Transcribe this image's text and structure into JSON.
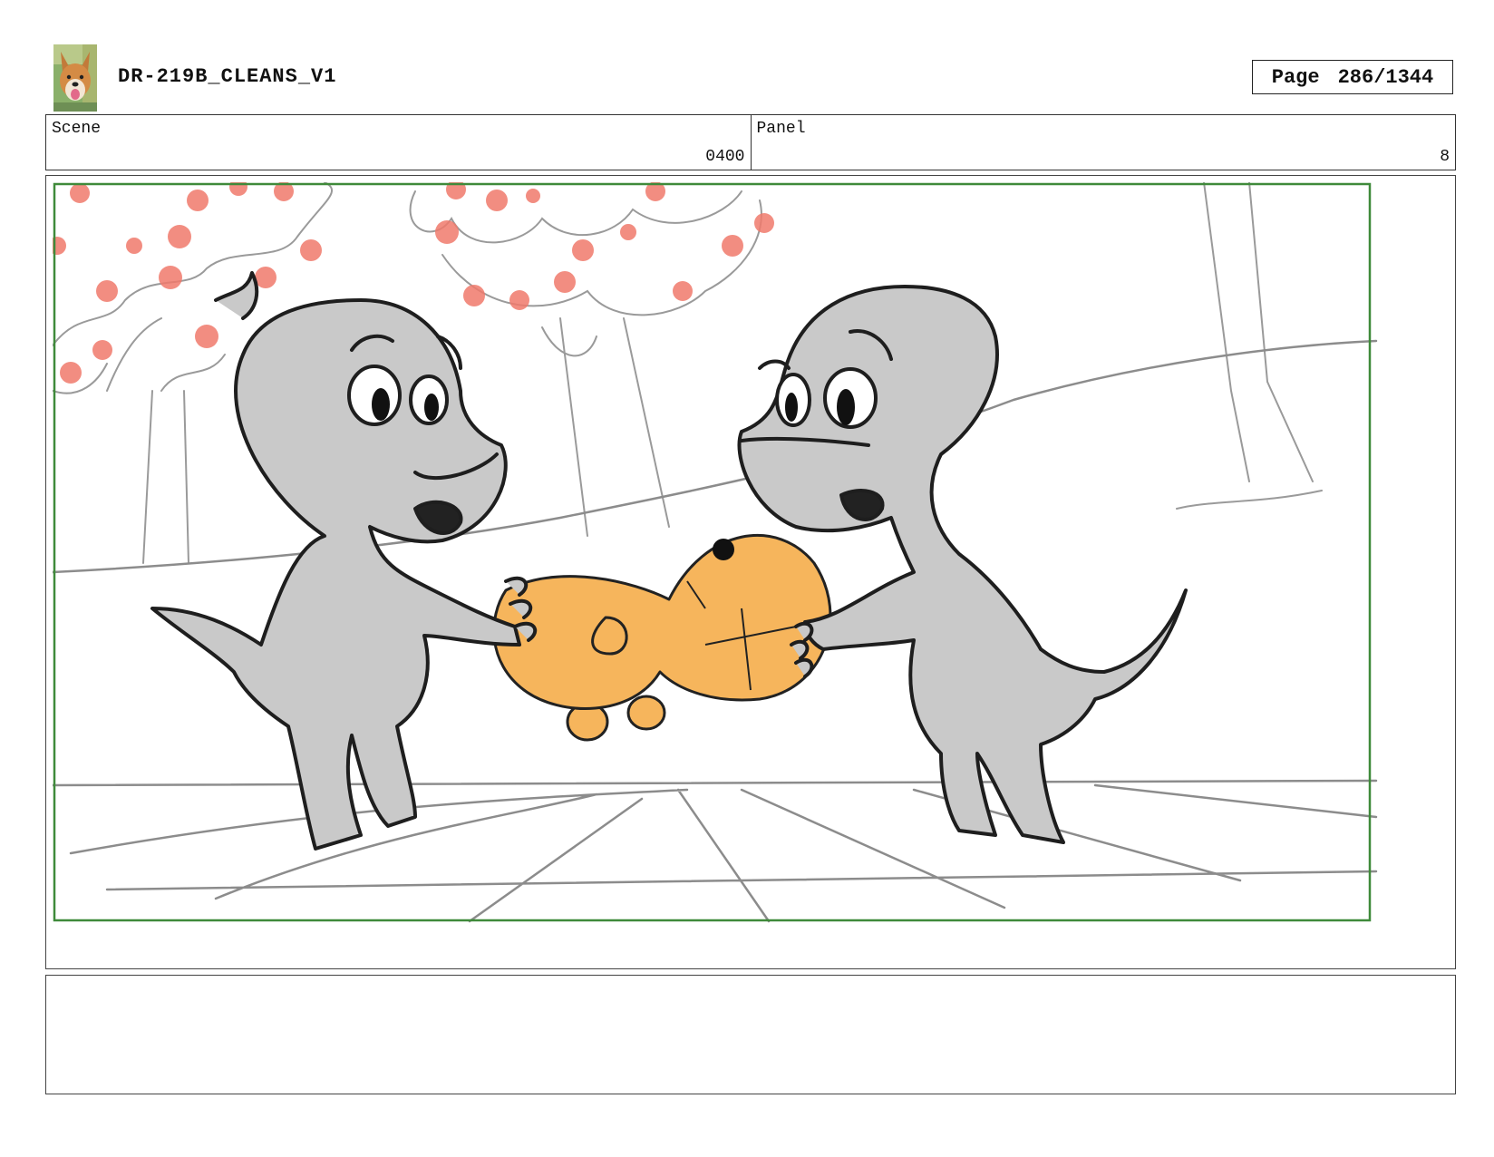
{
  "header": {
    "title": "DR-219B_CLEANS_V1",
    "page_label": "Page",
    "page_number": "286/1344"
  },
  "info": {
    "scene_label": "Scene",
    "scene_value": "0400",
    "panel_label": "Panel",
    "panel_value": "8"
  },
  "icons": {
    "thumbnail": "dog-photo-thumbnail"
  },
  "colors": {
    "safe_frame": "#3f8a3a",
    "dino": "#c9c9c9",
    "toy": "#f6b55c",
    "fruit": "#f07a6c"
  },
  "notes": {
    "text": ""
  }
}
